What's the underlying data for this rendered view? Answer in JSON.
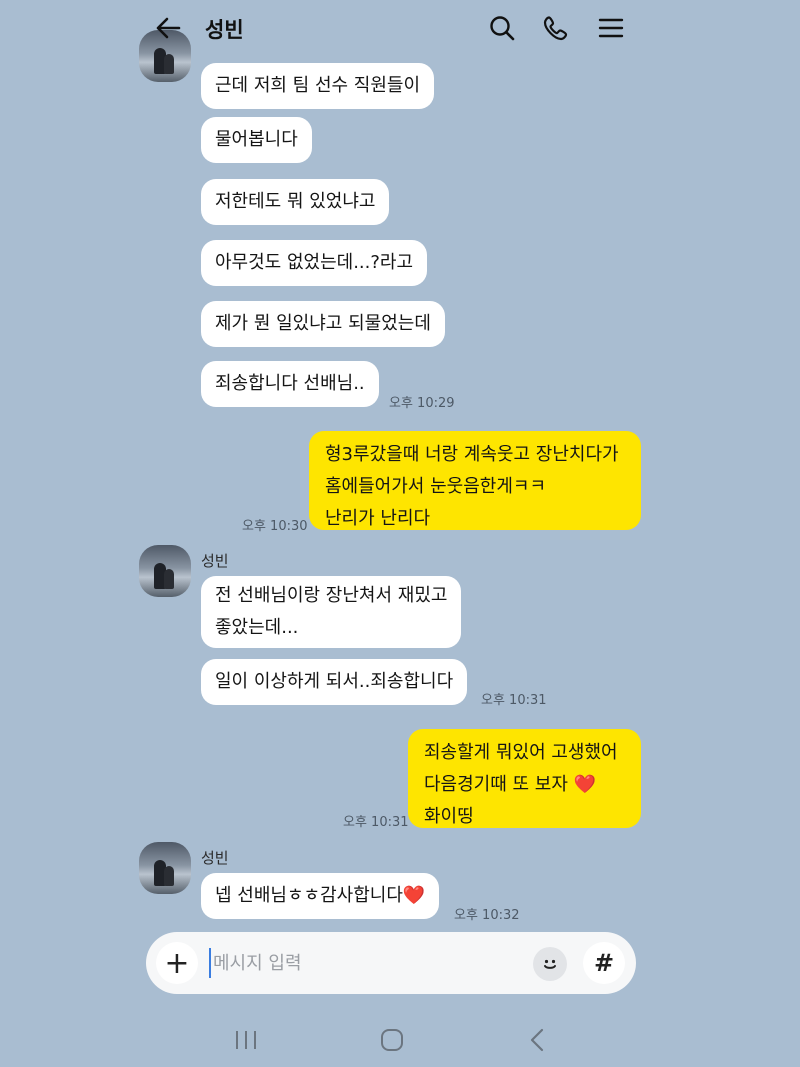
{
  "header": {
    "title": "성빈",
    "icons": [
      "arrow-left-icon",
      "search-icon",
      "phone-icon",
      "menu-icon"
    ]
  },
  "messages": [
    {
      "dir": "in",
      "text": "근데 저희 팀 선수 직원들이"
    },
    {
      "dir": "in",
      "text": "물어봅니다"
    },
    {
      "dir": "in",
      "text": "저한테도 뭐 있었냐고"
    },
    {
      "dir": "in",
      "text": "아무것도 없었는데...?라고"
    },
    {
      "dir": "in",
      "text": "제가 뭔 일있냐고 되물었는데"
    },
    {
      "dir": "in",
      "text": "죄송합니다 선배님..",
      "time": "오후 10:29"
    },
    {
      "dir": "out",
      "lines": [
        "형3루갔을때 너랑 계속웃고 장난치다가",
        "홈에들어가서 눈웃음한게ㅋㅋ",
        "난리가 난리다"
      ],
      "time": "오후 10:30"
    },
    {
      "dir": "in",
      "sender": "성빈",
      "lines": [
        "전 선배님이랑 장난쳐서 재밌고",
        "좋았는데..."
      ]
    },
    {
      "dir": "in",
      "text": "일이 이상하게 되서..죄송합니다",
      "time": "오후 10:31"
    },
    {
      "dir": "out",
      "lines": [
        "죄송할게 뭐있어 고생했어",
        "다음경기때 또 보자 ❤️",
        "화이띵"
      ],
      "time": "오후 10:31"
    },
    {
      "dir": "in",
      "sender": "성빈",
      "text": "넵 선배님ㅎㅎ감사합니다❤️",
      "time": "오후 10:32"
    }
  ],
  "input": {
    "placeholder": "메시지 입력",
    "value": ""
  },
  "input_icons": [
    "plus-icon",
    "emoji-icon",
    "hashtag-icon"
  ],
  "nav_icons": [
    "recent-apps-icon",
    "home-icon",
    "back-icon"
  ],
  "colors": {
    "background": "#a9bdd1",
    "outgoing_bubble": "#fee500",
    "incoming_bubble": "#ffffff",
    "heart": "#e0284f"
  }
}
